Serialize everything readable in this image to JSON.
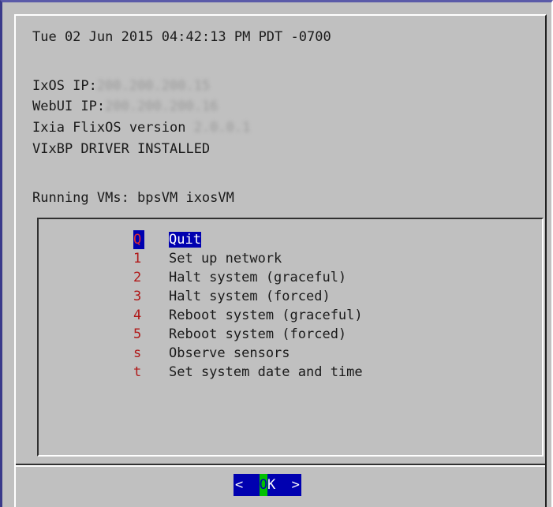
{
  "header": {
    "datetime": "Tue 02 Jun 2015 04:42:13 PM PDT -0700"
  },
  "info": {
    "ixos_label": "IxOS IP:",
    "ixos_value": "200.200.200.15",
    "webui_label": "WebUI IP:",
    "webui_value": "200.200.200.16",
    "flixos_label": "Ixia FlixOS version ",
    "flixos_value": "2.0.0.1",
    "driver_status": "VIxBP DRIVER INSTALLED",
    "running_vms": "Running VMs: bpsVM ixosVM"
  },
  "menu": {
    "items": [
      {
        "key": "Q",
        "label": "Quit",
        "selected": true
      },
      {
        "key": "1",
        "label": "Set up network"
      },
      {
        "key": "2",
        "label": "Halt system (graceful)"
      },
      {
        "key": "3",
        "label": "Halt system (forced)"
      },
      {
        "key": "4",
        "label": "Reboot system (graceful)"
      },
      {
        "key": "5",
        "label": "Reboot system (forced)"
      },
      {
        "key": "s",
        "label": "Observe sensors"
      },
      {
        "key": "t",
        "label": "Set system date and time"
      }
    ]
  },
  "buttons": {
    "ok_left": "<  ",
    "ok_hotkey": "O",
    "ok_rest": "K  >"
  },
  "colors": {
    "background": "#c0c0c0",
    "selection": "#0000b0",
    "hotkey": "#b01818",
    "button_hotkey": "#00c000"
  }
}
